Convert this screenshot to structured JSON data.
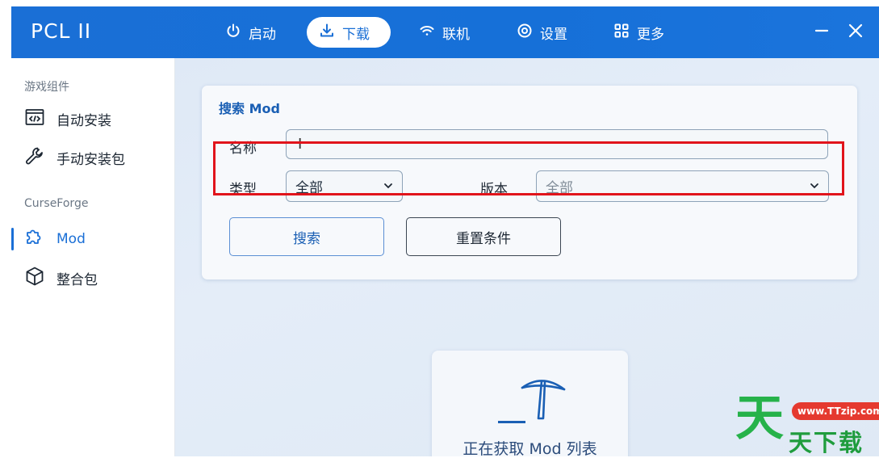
{
  "app": {
    "title": "PCL II"
  },
  "nav": [
    {
      "label": "启动",
      "icon": "power-icon",
      "active": false
    },
    {
      "label": "下载",
      "icon": "download-icon",
      "active": true
    },
    {
      "label": "联机",
      "icon": "wifi-icon",
      "active": false
    },
    {
      "label": "设置",
      "icon": "gear-icon",
      "active": false
    },
    {
      "label": "更多",
      "icon": "grid-icon",
      "active": false
    }
  ],
  "window_controls": {
    "minimize": "minimize-icon",
    "close": "close-icon"
  },
  "sidebar": {
    "group1": "游戏组件",
    "items1": [
      {
        "label": "自动安装",
        "icon": "code-window-icon"
      },
      {
        "label": "手动安装包",
        "icon": "wrench-icon"
      }
    ],
    "group2": "CurseForge",
    "items2": [
      {
        "label": "Mod",
        "icon": "puzzle-icon",
        "active": true
      },
      {
        "label": "整合包",
        "icon": "cube-icon"
      }
    ]
  },
  "search": {
    "title": "搜索 Mod",
    "name_label": "名称",
    "name_value": "",
    "type_label": "类型",
    "type_value": "全部",
    "version_label": "版本",
    "version_value": "全部",
    "search_button": "搜索",
    "reset_button": "重置条件"
  },
  "loading": {
    "text": "正在获取 Mod 列表",
    "icon": "pickaxe-icon"
  },
  "watermark": {
    "big": "天",
    "url": "www.TTzip.com",
    "tail": "天下载"
  },
  "colors": {
    "accent": "#1a6fd6",
    "highlight": "#e1141b"
  }
}
